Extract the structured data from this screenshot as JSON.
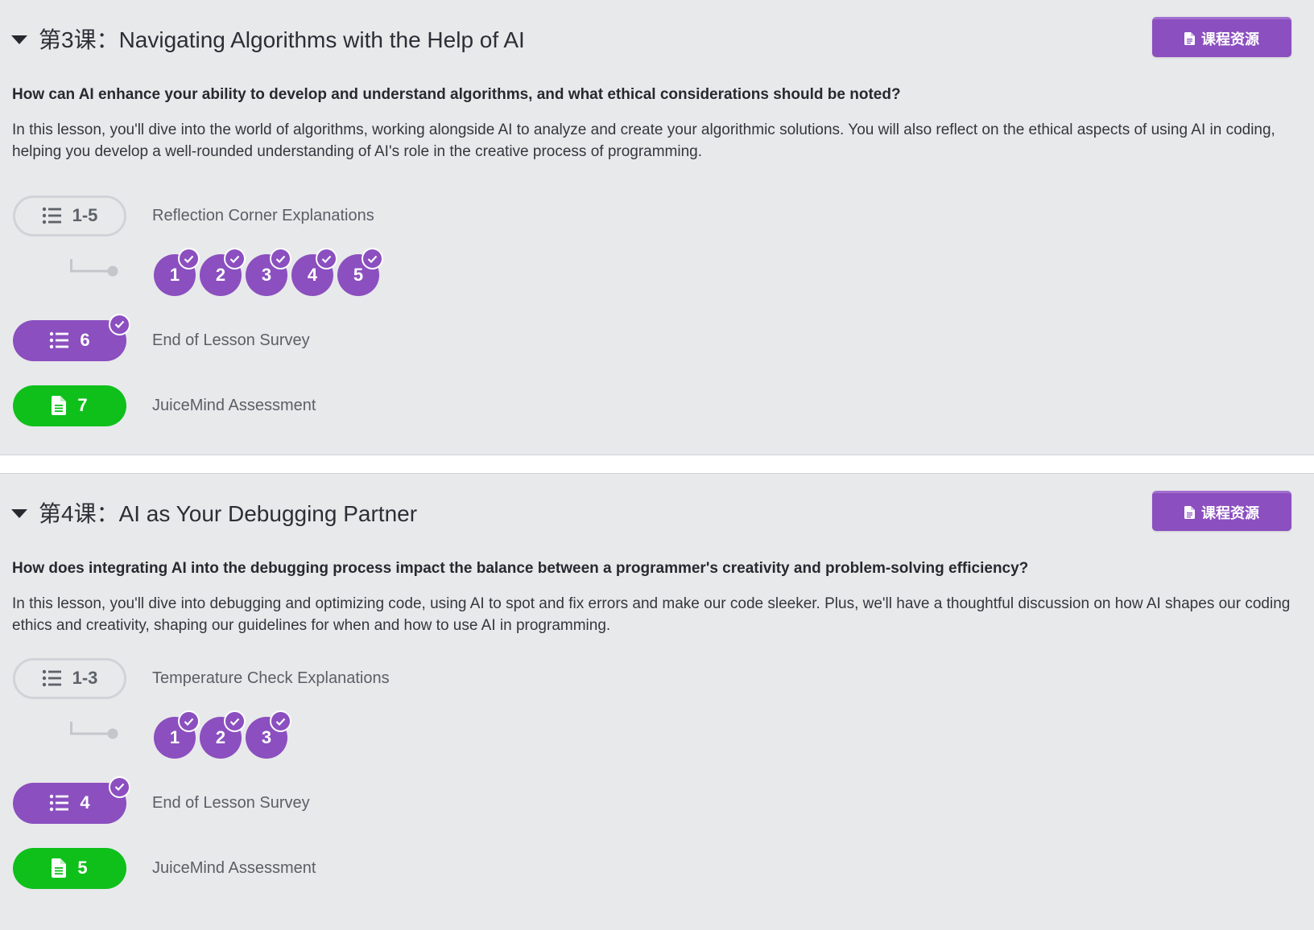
{
  "colors": {
    "purple": "#8b4fbf",
    "green": "#0fc01b",
    "background": "#e8e9eb"
  },
  "lessons": [
    {
      "title": "第3课：Navigating Algorithms with the Help of AI",
      "resources_button": "课程资源",
      "question": "How can AI enhance your ability to develop and understand algorithms, and what ethical considerations should be noted?",
      "description": "In this lesson, you'll dive into the world of algorithms, working alongside AI to analyze and create your algorithmic solutions. You will also reflect on the ethical aspects of using AI in coding, helping you develop a well-rounded understanding of AI's role in the creative process of programming.",
      "activities": {
        "group": {
          "range": "1-5",
          "label": "Reflection Corner Explanations",
          "icon": "list-icon",
          "items": [
            "1",
            "2",
            "3",
            "4",
            "5"
          ],
          "items_completed": true
        },
        "survey": {
          "number": "6",
          "label": "End of Lesson Survey",
          "icon": "list-icon",
          "completed": true
        },
        "assessment": {
          "number": "7",
          "label": "JuiceMind Assessment",
          "icon": "file-icon"
        }
      }
    },
    {
      "title": "第4课：AI as Your Debugging Partner",
      "resources_button": "课程资源",
      "question": "How does integrating AI into the debugging process impact the balance between a programmer's creativity and problem-solving efficiency?",
      "description": "In this lesson, you'll dive into debugging and optimizing code, using AI to spot and fix errors and make our code sleeker. Plus, we'll have a thoughtful discussion on how AI shapes our coding ethics and creativity, shaping our guidelines for when and how to use AI in programming.",
      "activities": {
        "group": {
          "range": "1-3",
          "label": "Temperature Check Explanations",
          "icon": "list-icon",
          "items": [
            "1",
            "2",
            "3"
          ],
          "items_completed": true
        },
        "survey": {
          "number": "4",
          "label": "End of Lesson Survey",
          "icon": "list-icon",
          "completed": true
        },
        "assessment": {
          "number": "5",
          "label": "JuiceMind Assessment",
          "icon": "file-icon"
        }
      }
    }
  ]
}
